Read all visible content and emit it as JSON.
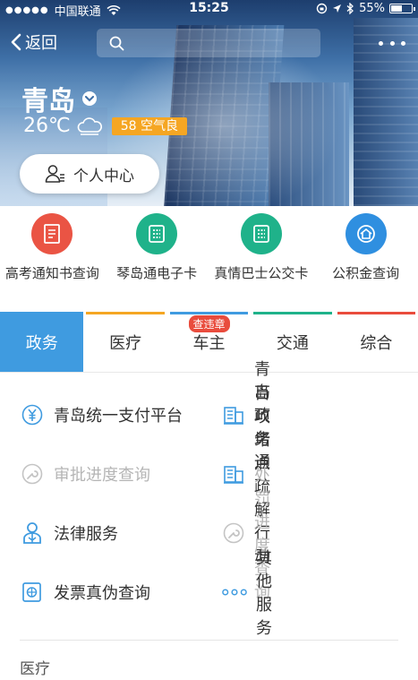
{
  "status_bar": {
    "carrier": "中国联通",
    "time": "15:25",
    "battery": "55%",
    "battery_level": 0.55
  },
  "nav": {
    "back_label": "返回",
    "search_placeholder": ""
  },
  "location": {
    "city": "青岛",
    "temperature": "26℃",
    "air_quality": "58 空气良"
  },
  "personal_center": {
    "label": "个人中心"
  },
  "quick_services": [
    {
      "label": "高考通知书查询",
      "color": "#ea5444",
      "icon": "document-icon"
    },
    {
      "label": "琴岛通电子卡",
      "color": "#1fb28a",
      "icon": "card-icon"
    },
    {
      "label": "真情巴士公交卡",
      "color": "#1fb28a",
      "icon": "bus-card-icon"
    },
    {
      "label": "公积金查询",
      "color": "#2f8fe0",
      "icon": "house-fund-icon"
    }
  ],
  "tabs": [
    {
      "label": "政务",
      "line_color": "#3f9be0",
      "active": true
    },
    {
      "label": "医疗",
      "line_color": "#f5a623"
    },
    {
      "label": "车主",
      "line_color": "#3f9be0",
      "badge": "查违章"
    },
    {
      "label": "交通",
      "line_color": "#1fb28a"
    },
    {
      "label": "综合",
      "line_color": "#e94c3d"
    }
  ],
  "services": [
    {
      "label": "青岛统一支付平台",
      "icon": "yuan-icon",
      "enabled": true
    },
    {
      "label": "青岛政务通",
      "icon": "building-icon",
      "enabled": true
    },
    {
      "label": "审批进度查询",
      "icon": "wrench-icon",
      "enabled": false
    },
    {
      "label": "百项堵点疏解行动",
      "icon": "building-icon",
      "enabled": true
    },
    {
      "label": "法律服务",
      "icon": "lawyer-icon",
      "enabled": true
    },
    {
      "label": "处罚进度查询",
      "icon": "wrench-icon",
      "enabled": false
    },
    {
      "label": "发票真伪查询",
      "icon": "invoice-icon",
      "enabled": true
    },
    {
      "label": "其他服务",
      "icon": "more-dots-icon",
      "enabled": true
    }
  ],
  "next_section": {
    "title": "医疗"
  },
  "colors": {
    "accent": "#3f9be0",
    "aqi_badge": "#f5a623"
  }
}
